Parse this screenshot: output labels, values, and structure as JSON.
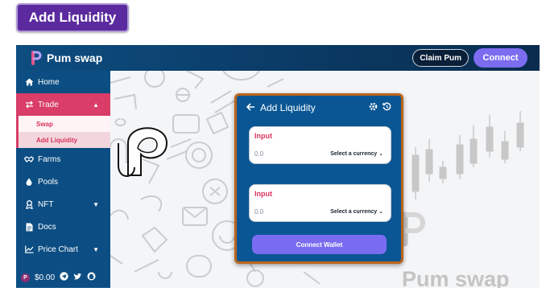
{
  "page_heading": "Add Liquidity",
  "brand": {
    "name": "Pum swap",
    "logo_icon": "pum-logo-icon",
    "accent": "#d93d68"
  },
  "topbar": {
    "claim_label": "Claim Pum",
    "connect_label": "Connect"
  },
  "sidebar": {
    "items": [
      {
        "label": "Home",
        "icon": "home-icon"
      },
      {
        "label": "Trade",
        "icon": "swap-arrows-icon",
        "expanded": true
      },
      {
        "label": "Farms",
        "icon": "handshake-icon"
      },
      {
        "label": "Pools",
        "icon": "droplet-icon"
      },
      {
        "label": "NFT",
        "icon": "badge-icon"
      },
      {
        "label": "Docs",
        "icon": "document-icon"
      },
      {
        "label": "Price Chart",
        "icon": "line-chart-icon"
      }
    ],
    "trade_sub": [
      "Swap",
      "Add Liquidity"
    ],
    "footer": {
      "price": "$0.00"
    }
  },
  "card": {
    "title": "Add Liquidity",
    "input_a": {
      "label": "Input",
      "value": "0.0",
      "select_label": "Select a currency"
    },
    "plus": "+",
    "input_b": {
      "label": "Input",
      "value": "0.0",
      "select_label": "Select a currency"
    },
    "connect_wallet_label": "Connect Wallet"
  },
  "watermark": {
    "text": "Pum swap"
  }
}
